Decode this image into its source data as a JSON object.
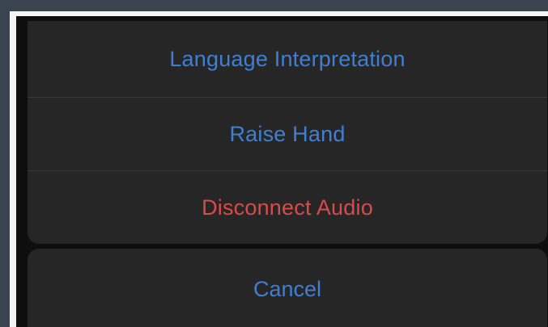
{
  "action_sheet": {
    "items": [
      {
        "label": "Language Interpretation",
        "color": "#3f7fd3"
      },
      {
        "label": "Raise Hand",
        "color": "#3f7fd3"
      },
      {
        "label": "Disconnect Audio",
        "color": "#d94a4a"
      }
    ],
    "cancel_label": "Cancel"
  }
}
